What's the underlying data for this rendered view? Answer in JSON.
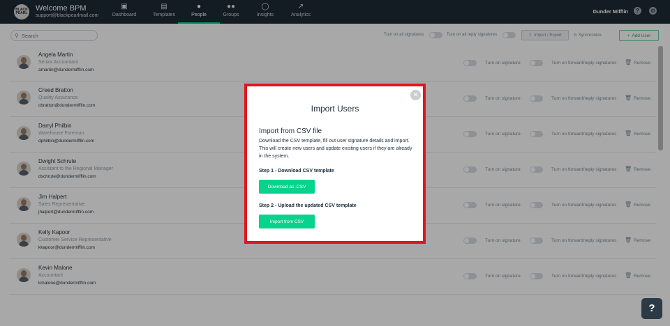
{
  "header": {
    "logo_text": "BLACK PEARL",
    "title": "Welcome BPM",
    "email": "support@blackpearlmail.com",
    "company": "Dunder Mifflin",
    "nav": [
      {
        "label": "Dashboard",
        "icon": "monitor-icon"
      },
      {
        "label": "Templates",
        "icon": "templates-icon"
      },
      {
        "label": "People",
        "icon": "person-icon"
      },
      {
        "label": "Groups",
        "icon": "group-icon"
      },
      {
        "label": "Insights",
        "icon": "lightbulb-icon"
      },
      {
        "label": "Analytics",
        "icon": "chart-icon"
      }
    ],
    "active_nav": "People"
  },
  "toolbar": {
    "search_placeholder": "Search",
    "all_signatures_label": "Turn on all signatures",
    "all_reply_label": "Turn on all reply signatures",
    "import_export_label": "Import / Export",
    "sync_label": "Synchronize",
    "add_user_label": "Add User"
  },
  "row_labels": {
    "signature": "Turn on signature",
    "forward_reply": "Turn on forward/reply signatures",
    "remove": "Remove"
  },
  "users": [
    {
      "name": "Angela Martin",
      "role": "Senior Accountant",
      "email": "amartin@dundermifflin.com"
    },
    {
      "name": "Creed Bratton",
      "role": "Quality Assurance",
      "email": "cbratton@dundermifflin.com"
    },
    {
      "name": "Darryl Philbin",
      "role": "Warehouse Foreman",
      "email": "dphilbin@dundermifflin.com"
    },
    {
      "name": "Dwight Schrute",
      "role": "Assistant to the Regional Manager",
      "email": "dschrute@dundermifflin.com"
    },
    {
      "name": "Jim Halpert",
      "role": "Sales Representative",
      "email": "jhalpert@dundermifflin.com"
    },
    {
      "name": "Kelly Kapoor",
      "role": "Customer Service Representative",
      "email": "kkapoor@dundermifflin.com"
    },
    {
      "name": "Kevin Malone",
      "role": "Accountant",
      "email": "kmalone@dundermifflin.com"
    }
  ],
  "modal": {
    "title": "Import Users",
    "subtitle": "Import from CSV file",
    "description": "Download the CSV template, fill out user signature details and import. This will create new users and update existing users if they are already in the system.",
    "step1": "Step 1 - Download CSV template",
    "download_btn": "Download as .CSV",
    "step2": "Step 2 - Upload the updated CSV template",
    "import_btn": "Import from CSV",
    "close_icon": "×"
  },
  "help_label": "?",
  "colors": {
    "nav_bg": "#1e2b35",
    "accent_green": "#08d38d",
    "highlight_red": "#e0161e"
  }
}
